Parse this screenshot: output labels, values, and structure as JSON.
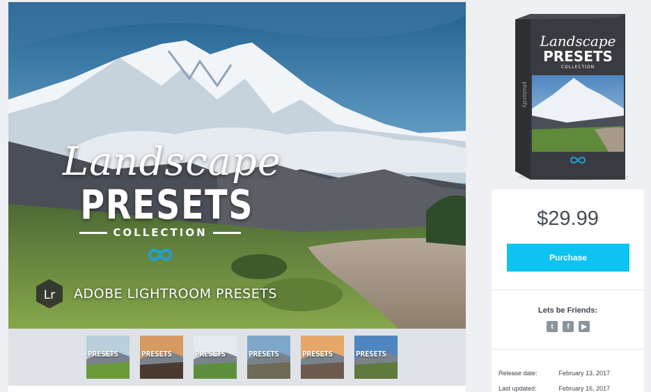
{
  "hero": {
    "script_title": "Landscape",
    "main_title": "PRESETS",
    "subtitle": "COLLECTION",
    "lr_badge": "Lr",
    "lr_text": "ADOBE LIGHTROOM PRESETS"
  },
  "thumbnails": [
    {
      "label": "PRESETS",
      "sky": "#b9cfdc",
      "ground": "#6a9a3a"
    },
    {
      "label": "PRESETS",
      "sky": "#d79a62",
      "ground": "#4b3a30"
    },
    {
      "label": "PRESETS",
      "sky": "#e4ebef",
      "ground": "#5e8f3e"
    },
    {
      "label": "PRESETS",
      "sky": "#7ea7c9",
      "ground": "#6f6a56"
    },
    {
      "label": "PRESETS",
      "sky": "#e6a76a",
      "ground": "#6d5a4e"
    },
    {
      "label": "PRESETS",
      "sky": "#4f86c0",
      "ground": "#5f7a3c"
    }
  ],
  "product_box": {
    "script_title": "Landscape",
    "main_title": "PRESETS",
    "subtitle": "COLLECTION",
    "spine": "photonify"
  },
  "purchase": {
    "price": "$29.99",
    "button_label": "Purchase",
    "friends_heading": "Lets be Friends:",
    "social": [
      "twitter-icon",
      "facebook-icon",
      "youtube-icon"
    ],
    "release_label": "Release date:",
    "release_value": "February 13, 2017",
    "updated_label": "Last updated:",
    "updated_value": "February 16, 2017"
  },
  "colors": {
    "accent": "#0dc3f2",
    "price_text": "#444c55",
    "icon_gray": "#8a959e"
  }
}
